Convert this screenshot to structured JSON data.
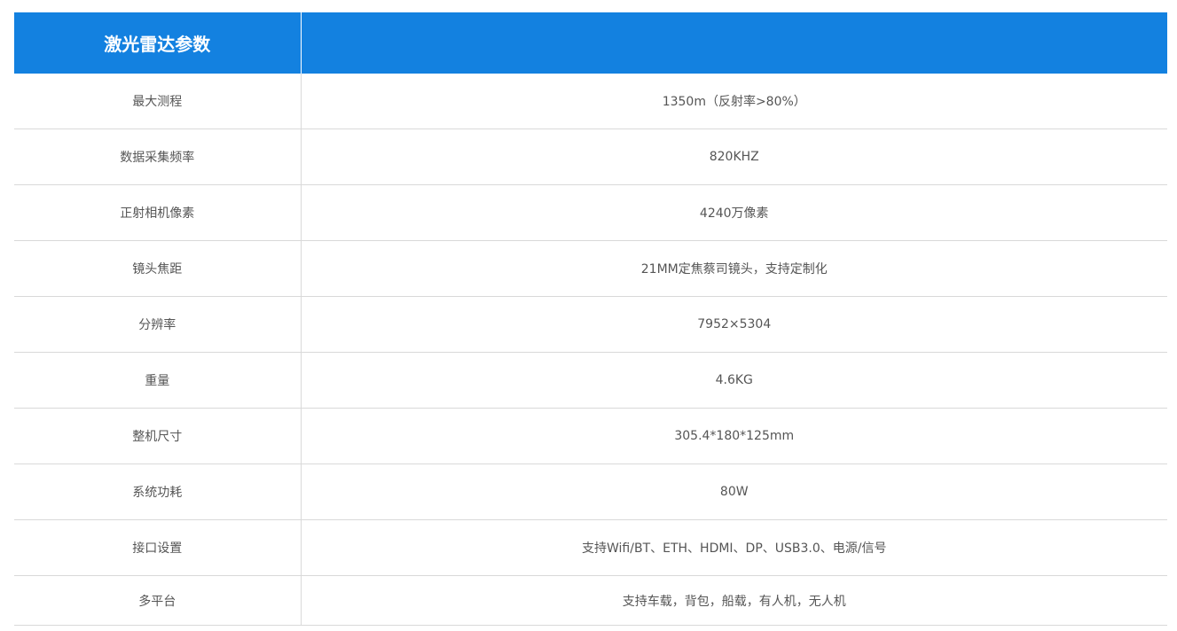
{
  "table": {
    "title": "激光雷达参数",
    "title_value": "",
    "rows": [
      {
        "label": "最大测程",
        "value": "1350m（反射率>80%）"
      },
      {
        "label": "数据采集频率",
        "value": "820KHZ"
      },
      {
        "label": "正射相机像素",
        "value": "4240万像素"
      },
      {
        "label": "镜头焦距",
        "value": "21MM定焦蔡司镜头，支持定制化"
      },
      {
        "label": "分辨率",
        "value": "7952×5304"
      },
      {
        "label": "重量",
        "value": "4.6KG"
      },
      {
        "label": "整机尺寸",
        "value": "305.4*180*125mm"
      },
      {
        "label": "系统功耗",
        "value": "80W"
      },
      {
        "label": "接口设置",
        "value": "支持Wifi/BT、ETH、HDMI、DP、USB3.0、电源/信号"
      },
      {
        "label": "多平台",
        "value": "支持车载，背包，船载，有人机，无人机"
      }
    ]
  },
  "colors": {
    "header_bg": "#1381e0",
    "header_text": "#ffffff",
    "body_text": "#555555",
    "border": "#d9d9d9"
  }
}
